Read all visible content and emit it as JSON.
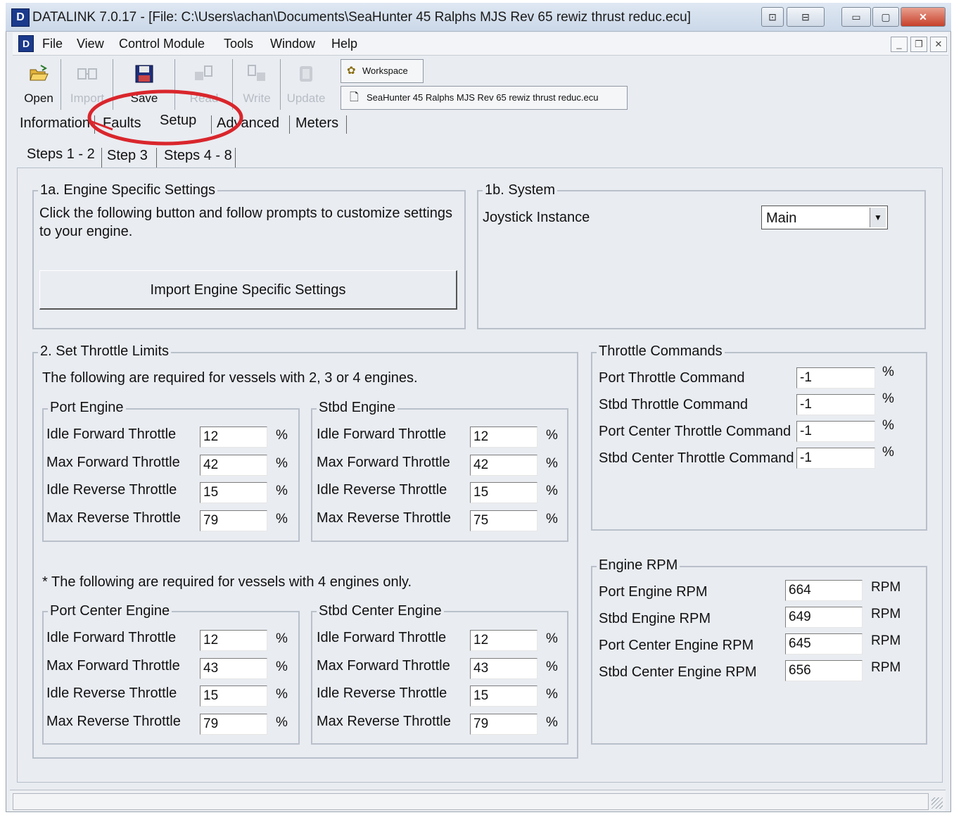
{
  "window": {
    "title": "DATALINK 7.0.17 - [File: C:\\Users\\achan\\Documents\\SeaHunter 45 Ralphs MJS Rev 65 rewiz thrust reduc.ecu]",
    "logo_glyph": "D",
    "caption_glyphs": {
      "min": "▭",
      "max": "▢",
      "close": "✕"
    }
  },
  "menu": {
    "items": [
      "File",
      "View",
      "Control Module",
      "Tools",
      "Window",
      "Help"
    ],
    "mdi": {
      "min": "_",
      "restore": "❐",
      "close": "✕"
    }
  },
  "toolbar": {
    "open": "Open",
    "import": "Import",
    "save": "Save",
    "read": "Read",
    "write": "Write",
    "update": "Update",
    "workspace": "Workspace",
    "file_name": "SeaHunter 45 Ralphs MJS Rev 65 rewiz thrust reduc.ecu",
    "icons": {
      "open": "folder-open-icon",
      "import": "import-icon",
      "save": "floppy-disk-icon",
      "read": "read-icon",
      "write": "write-icon",
      "update": "update-icon",
      "workspace": "workspace-icon",
      "file": "document-icon"
    }
  },
  "tabs": {
    "main": [
      "Information",
      "Faults",
      "Setup",
      "Advanced",
      "Meters"
    ],
    "active_main": "Setup",
    "sub": [
      "Steps 1 - 2",
      "Step 3",
      "Steps 4 - 8"
    ],
    "active_sub": "Steps 1 - 2"
  },
  "engine_specific": {
    "title": "1a. Engine Specific Settings",
    "description_line1": "Click the following button and follow prompts to customize settings",
    "description_line2": "to your engine.",
    "button": "Import Engine Specific Settings"
  },
  "system": {
    "title": "1b. System",
    "joystick_label": "Joystick Instance",
    "joystick_value": "Main"
  },
  "throttle_limits": {
    "title": "2. Set Throttle Limits",
    "note": "The following are required for vessels with 2, 3 or 4 engines.",
    "note4": "* The following are required for vessels with 4 engines only.",
    "unit": "%",
    "row_labels": [
      "Idle Forward Throttle",
      "Max Forward Throttle",
      "Idle Reverse Throttle",
      "Max Reverse Throttle"
    ],
    "port": {
      "title": "Port Engine",
      "values": [
        "12",
        "42",
        "15",
        "79"
      ]
    },
    "stbd": {
      "title": "Stbd Engine",
      "values": [
        "12",
        "42",
        "15",
        "75"
      ]
    },
    "port_center": {
      "title": "Port Center Engine",
      "values": [
        "12",
        "43",
        "15",
        "79"
      ]
    },
    "stbd_center": {
      "title": "Stbd Center Engine",
      "values": [
        "12",
        "43",
        "15",
        "79"
      ]
    }
  },
  "throttle_commands": {
    "title": "Throttle Commands",
    "unit": "%",
    "rows": [
      {
        "label": "Port Throttle Command",
        "value": "-1"
      },
      {
        "label": "Stbd Throttle Command",
        "value": "-1"
      },
      {
        "label": "Port Center Throttle Command",
        "value": "-1"
      },
      {
        "label": "Stbd Center Throttle Command",
        "value": "-1"
      }
    ]
  },
  "engine_rpm": {
    "title": "Engine RPM",
    "unit": "RPM",
    "rows": [
      {
        "label": "Port Engine RPM",
        "value": "664"
      },
      {
        "label": "Stbd Engine RPM",
        "value": "649"
      },
      {
        "label": "Port Center Engine RPM",
        "value": "645"
      },
      {
        "label": "Stbd Center Engine RPM",
        "value": "656"
      }
    ]
  },
  "colors": {
    "highlight_circle": "#d9262c",
    "panel": "#e9ecf1",
    "titlebar": "#cbd8e8"
  }
}
